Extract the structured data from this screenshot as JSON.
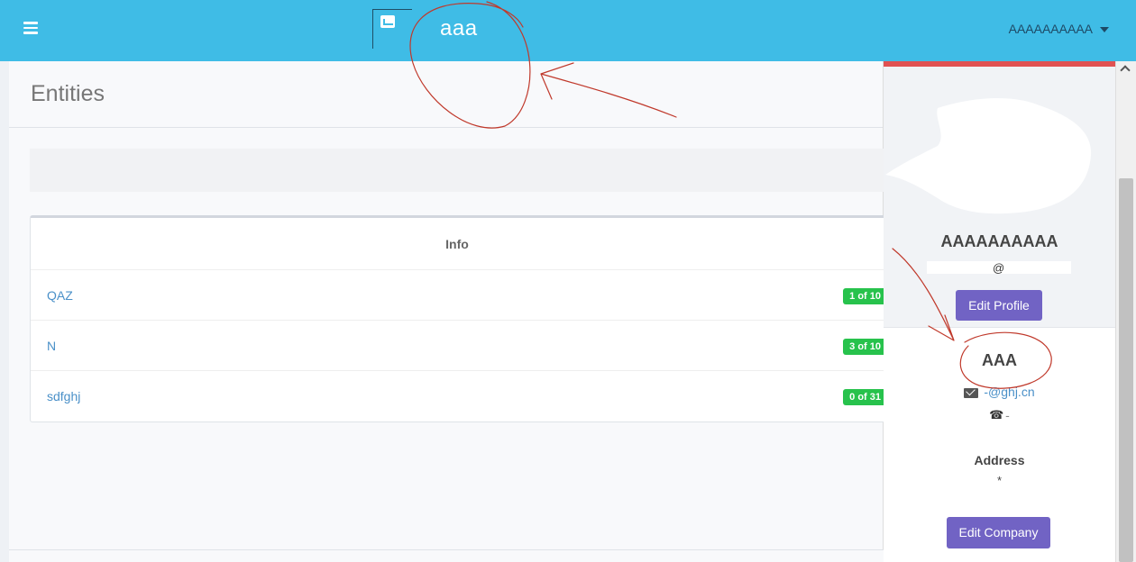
{
  "topbar": {
    "brand": "aaa",
    "user_name": "AAAAAAAAAA"
  },
  "page": {
    "title": "Entities"
  },
  "table": {
    "header": "Info",
    "rows": [
      {
        "name": "QAZ",
        "badge": "1 of 10"
      },
      {
        "name": "N",
        "badge": "3 of 10"
      },
      {
        "name": "sdfghj",
        "badge": "0 of 31"
      }
    ]
  },
  "sidebar": {
    "profile_name": "AAAAAAAAAA",
    "profile_email": "@",
    "edit_profile": "Edit Profile",
    "company_name": "AAA",
    "company_email": "-@ghj.cn",
    "company_phone": "-",
    "address_label": "Address",
    "address_value": "*",
    "edit_company": "Edit Company"
  },
  "colors": {
    "topbar": "#3fbce6",
    "badge": "#27c24c",
    "button": "#7163c4",
    "profile_top_border": "#e05252",
    "annotation": "#c0392b"
  },
  "icons": {
    "menu": "hamburger-icon",
    "logo": "image-icon",
    "dropdown": "caret-down-icon",
    "mail": "envelope-icon",
    "phone": "phone-icon"
  }
}
